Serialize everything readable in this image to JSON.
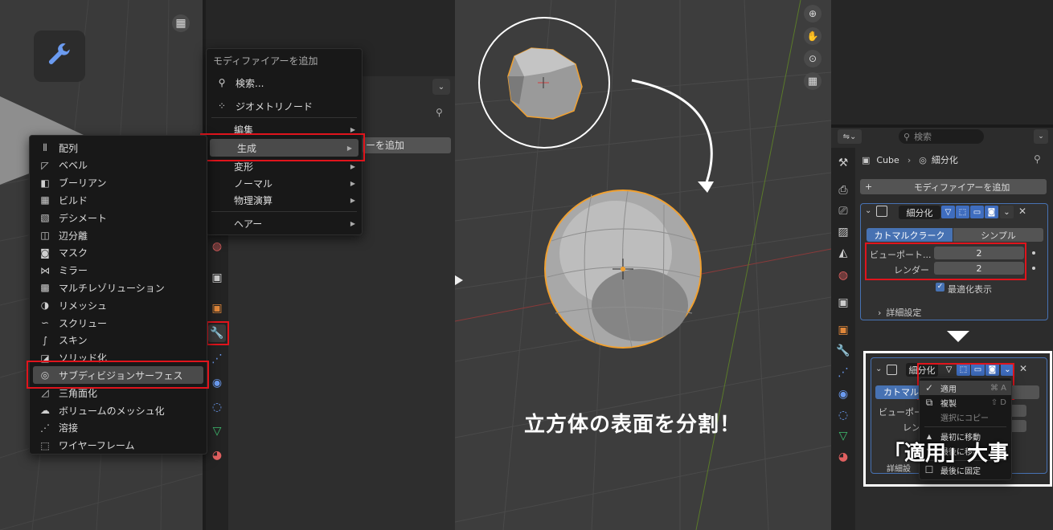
{
  "left_menu": {
    "items": [
      {
        "icon": "array-icon",
        "label": "配列"
      },
      {
        "icon": "bevel-icon",
        "label": "ベベル"
      },
      {
        "icon": "boolean-icon",
        "label": "ブーリアン"
      },
      {
        "icon": "build-icon",
        "label": "ビルド"
      },
      {
        "icon": "decimate-icon",
        "label": "デシメート"
      },
      {
        "icon": "edge-split-icon",
        "label": "辺分離"
      },
      {
        "icon": "mask-icon",
        "label": "マスク"
      },
      {
        "icon": "mirror-icon",
        "label": "ミラー"
      },
      {
        "icon": "multires-icon",
        "label": "マルチレゾリューション"
      },
      {
        "icon": "remesh-icon",
        "label": "リメッシュ"
      },
      {
        "icon": "screw-icon",
        "label": "スクリュー"
      },
      {
        "icon": "skin-icon",
        "label": "スキン"
      },
      {
        "icon": "solidify-icon",
        "label": "ソリッド化"
      },
      {
        "icon": "subsurf-icon",
        "label": "サブディビジョンサーフェス"
      },
      {
        "icon": "triangulate-icon",
        "label": "三角面化"
      },
      {
        "icon": "volume-icon",
        "label": "ボリュームのメッシュ化"
      },
      {
        "icon": "weld-icon",
        "label": "溶接"
      },
      {
        "icon": "wireframe-icon",
        "label": "ワイヤーフレーム"
      }
    ]
  },
  "add_menu": {
    "title": "モディファイアーを追加",
    "search": "検索...",
    "geometry_nodes": "ジオメトリノード",
    "categories": [
      "編集",
      "生成",
      "変形",
      "ノーマル",
      "物理演算",
      "ヘアー"
    ]
  },
  "middle_panel": {
    "add_modifier_partial": "ーを追加"
  },
  "caption": "立方体の表面を分割！",
  "right_panel": {
    "search_placeholder": "検索",
    "breadcrumb_object": "Cube",
    "breadcrumb_modifier": "細分化",
    "add_modifier": "モディファイアーを追加",
    "modifier_name": "細分化",
    "tab_catmull": "カトマルクラーク",
    "tab_simple": "シンプル",
    "viewport_label": "ビューポート...",
    "viewport_value": "2",
    "render_label": "レンダー",
    "render_value": "2",
    "optimal_label": "最適化表示",
    "advanced_label": "詳細設定"
  },
  "bottom_panel": {
    "modifier_name": "細分化",
    "tab_partial": "カトマルク",
    "viewport_partial": "ビューポー",
    "render_partial": "レン",
    "advanced_partial": "詳細設",
    "menu": {
      "apply": "適用",
      "apply_shortcut": "⌘ A",
      "duplicate": "複製",
      "duplicate_shortcut": "⇧ D",
      "copy_to_selected": "選択にコピー",
      "move_first": "最初に移動",
      "move_last": "最後に移動",
      "pin_last": "最後に固定"
    },
    "callout": "「適用」大事"
  },
  "colors": {
    "accent": "#4772b3",
    "highlight": "#e0141c",
    "selection": "#f0a030"
  }
}
